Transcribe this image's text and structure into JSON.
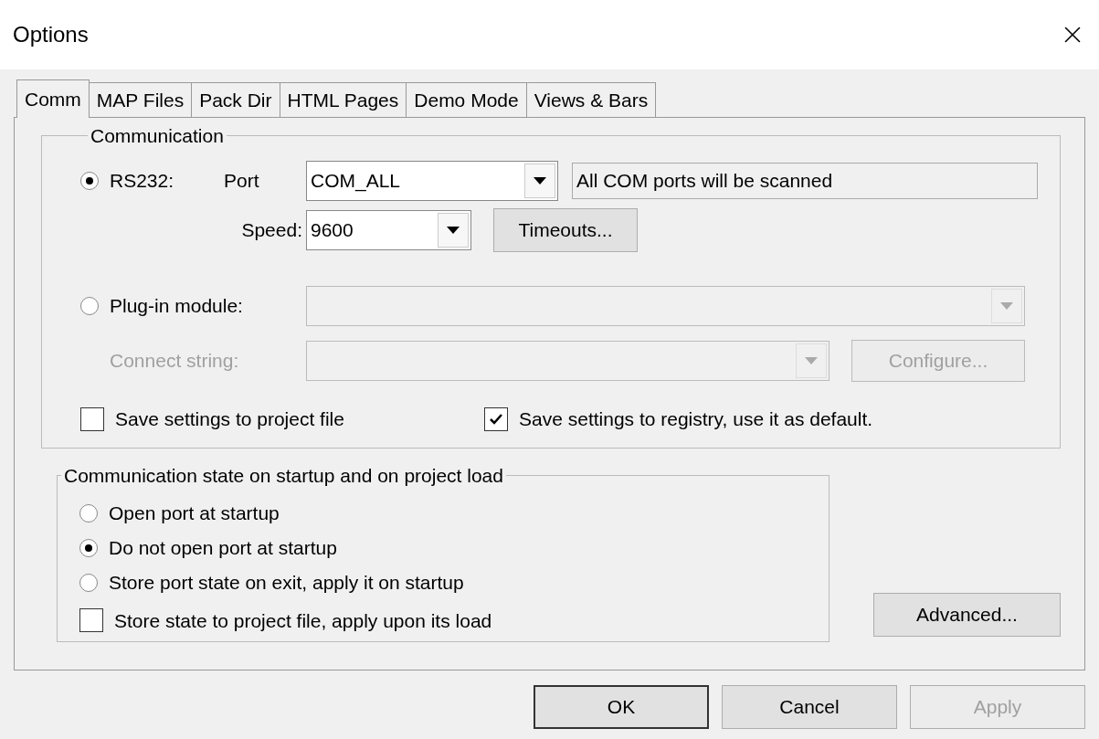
{
  "window": {
    "title": "Options"
  },
  "tabs": [
    {
      "label": "Comm",
      "selected": true
    },
    {
      "label": "MAP Files",
      "selected": false
    },
    {
      "label": "Pack Dir",
      "selected": false
    },
    {
      "label": "HTML Pages",
      "selected": false
    },
    {
      "label": "Demo Mode",
      "selected": false
    },
    {
      "label": "Views & Bars",
      "selected": false
    }
  ],
  "communication": {
    "title": "Communication",
    "rs232": {
      "label": "RS232:",
      "selected": true
    },
    "port_label": "Port",
    "port_value": "COM_ALL",
    "port_note": "All COM ports will be scanned",
    "speed_label": "Speed:",
    "speed_value": "9600",
    "timeouts_button": "Timeouts...",
    "plugin": {
      "label": "Plug-in module:",
      "selected": false,
      "disabled": false
    },
    "plugin_combo": {
      "disabled": true
    },
    "connect_label": {
      "text": "Connect string:",
      "disabled": true
    },
    "connect_combo": {
      "disabled": true
    },
    "configure_button": {
      "label": "Configure...",
      "disabled": true
    },
    "checkboxes": [
      {
        "label": "Save settings to project file",
        "checked": false
      },
      {
        "label": "Save settings to registry, use it as default.",
        "checked": true
      }
    ]
  },
  "startup": {
    "title": "Communication state on startup and on project load",
    "options": [
      {
        "label": "Open port at startup",
        "selected": false
      },
      {
        "label": "Do not open port at startup",
        "selected": true
      },
      {
        "label": "Store port state on exit, apply it on startup",
        "selected": false
      }
    ],
    "checkbox": {
      "label": "Store state to project file, apply upon its load",
      "checked": false
    }
  },
  "advanced_button": "Advanced...",
  "buttons": [
    {
      "label": "OK",
      "default": true,
      "disabled": false
    },
    {
      "label": "Cancel",
      "default": false,
      "disabled": false
    },
    {
      "label": "Apply",
      "default": false,
      "disabled": true
    }
  ]
}
